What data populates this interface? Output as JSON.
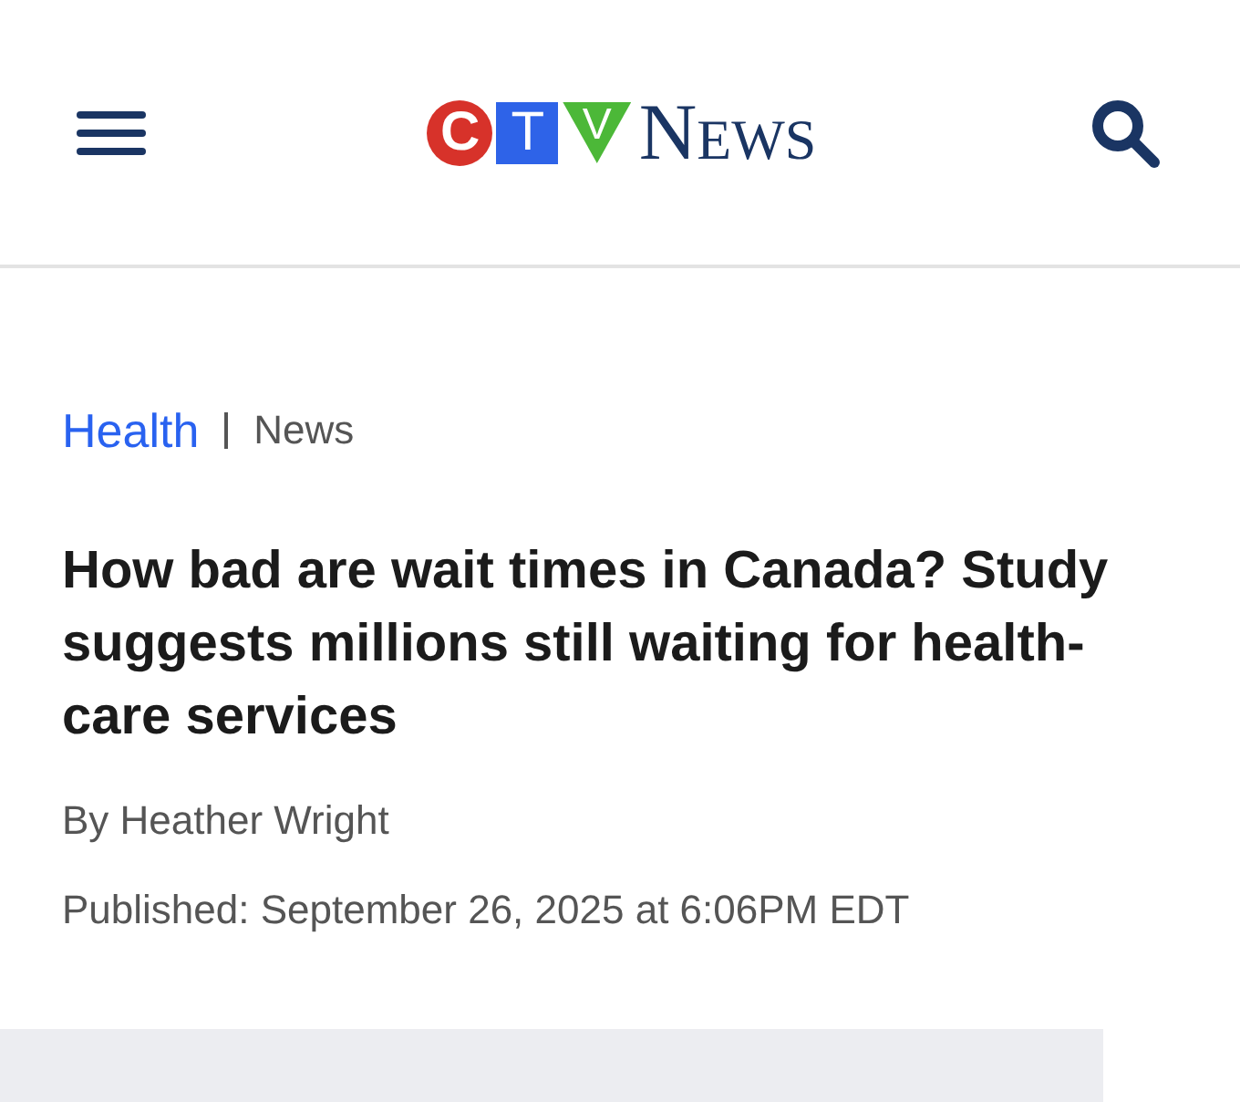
{
  "header": {
    "logo": {
      "letters": [
        "C",
        "T",
        "V"
      ],
      "wordmark": "News"
    }
  },
  "article": {
    "section": "Health",
    "subsection": "News",
    "headline": "How bad are wait times in Canada? Study suggests millions still waiting for health-care services",
    "byline": "By Heather Wright",
    "published": "Published: September 26, 2025 at 6:06PM EDT"
  }
}
